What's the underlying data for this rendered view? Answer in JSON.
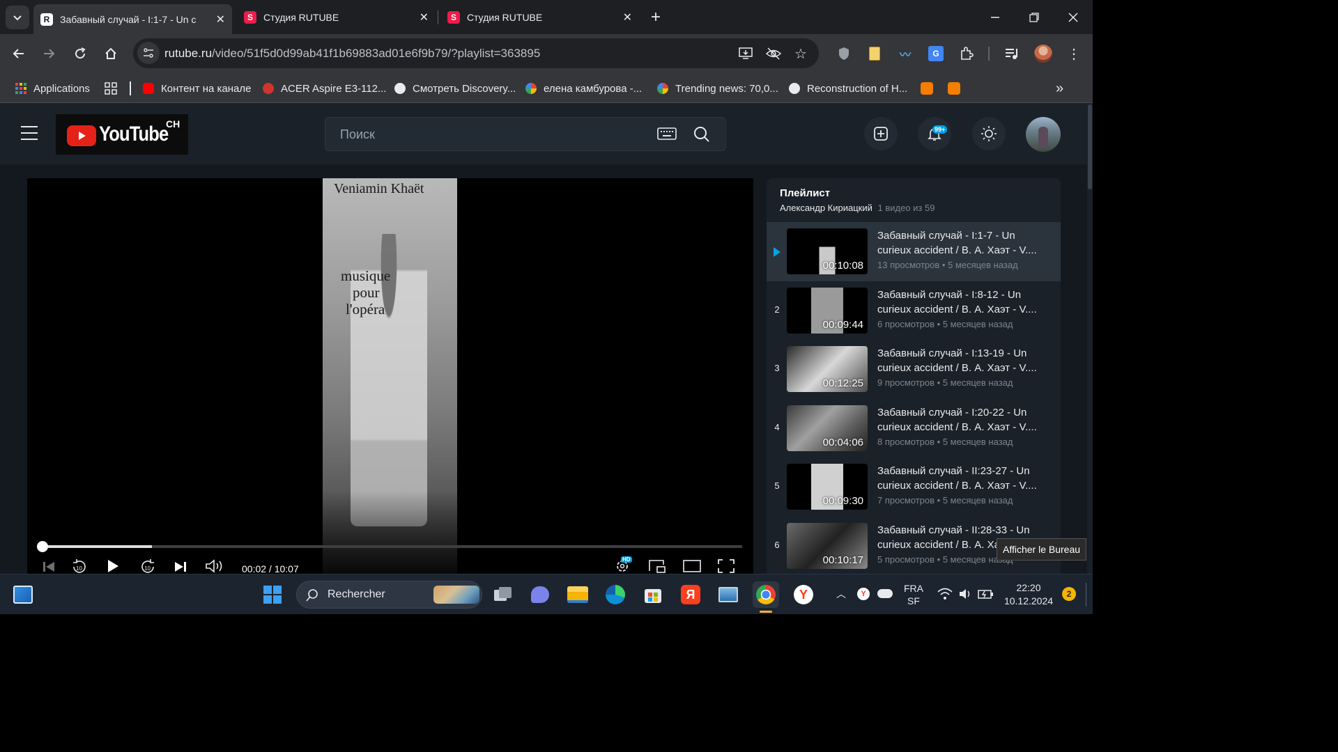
{
  "browser": {
    "tabs": [
      {
        "title": "Забавный случай - I:1-7 - Un c",
        "favicon_letter": "R",
        "active": true
      },
      {
        "title": "Студия RUTUBE",
        "favicon_letter": "S",
        "active": false
      },
      {
        "title": "Студия RUTUBE",
        "favicon_letter": "S",
        "active": false
      }
    ],
    "url_host": "rutube.ru",
    "url_path": "/video/51f5d0d99ab41f1b69883ad01e6f9b79/?playlist=363895",
    "bookmarks": [
      {
        "label": "Applications",
        "icon": "apps-grid-icon",
        "color": "#e8453c"
      },
      {
        "label": "Контент на канале",
        "icon": "youtube-icon",
        "color": "#ff0000"
      },
      {
        "label": "ACER Aspire E3-112...",
        "icon": "acer-icon",
        "color": "#d0342c"
      },
      {
        "label": "Смотреть Discovery...",
        "icon": "globe-icon",
        "color": "#e8eaed"
      },
      {
        "label": "елена камбурова -...",
        "icon": "google-icon",
        "color": "#4285f4"
      },
      {
        "label": "Trending news: 70,0...",
        "icon": "google-icon",
        "color": "#4285f4"
      },
      {
        "label": "Reconstruction of H...",
        "icon": "globe-icon",
        "color": "#e8eaed"
      }
    ],
    "more_bookmarks": "»"
  },
  "site": {
    "logo_text": "YouTube",
    "logo_badge": "CH",
    "search_placeholder": "Поиск",
    "notifications_badge": "99+"
  },
  "video": {
    "overlay_title": "Veniamin Khaët",
    "overlay_lines": [
      "musique",
      "pour",
      "l'opéra"
    ],
    "time_current": "00:02",
    "time_total": "10:07",
    "time_display": "00:02 / 10:07",
    "progress_fraction": 0.003,
    "buffered_fraction": 0.16,
    "quality_badge": "HD"
  },
  "playlist": {
    "heading": "Плейлист",
    "author": "Александр Кириацкий",
    "count_text": "1 видео из 59",
    "items": [
      {
        "num": "",
        "duration": "00:10:08",
        "title": "Забавный случай - I:1-7 - Un curieux accident / В. А. Хаэт - V....",
        "views": "13 просмотров",
        "age": "5 месяцев назад",
        "current": true
      },
      {
        "num": "2",
        "duration": "00:09:44",
        "title": "Забавный случай - I:8-12 - Un curieux accident / В. А. Хаэт - V....",
        "views": "6 просмотров",
        "age": "5 месяцев назад",
        "current": false
      },
      {
        "num": "3",
        "duration": "00:12:25",
        "title": "Забавный случай - I:13-19 - Un curieux accident / В. А. Хаэт - V....",
        "views": "9 просмотров",
        "age": "5 месяцев назад",
        "current": false
      },
      {
        "num": "4",
        "duration": "00:04:06",
        "title": "Забавный случай - I:20-22 - Un curieux accident / В. А. Хаэт - V....",
        "views": "8 просмотров",
        "age": "5 месяцев назад",
        "current": false
      },
      {
        "num": "5",
        "duration": "00:09:30",
        "title": "Забавный случай - II:23-27 - Un curieux accident / В. А. Хаэт - V....",
        "views": "7 просмотров",
        "age": "5 месяцев назад",
        "current": false
      },
      {
        "num": "6",
        "duration": "00:10:17",
        "title": "Забавный случай - II:28-33 - Un curieux accident / В. А. Хаэт - V....",
        "views": "5 просмотров",
        "age": "5 месяцев назад",
        "current": false
      }
    ]
  },
  "tooltip": "Afficher le Bureau",
  "taskbar": {
    "search_label": "Rechercher",
    "lang": "FRA",
    "lang_sub": "SF",
    "time": "22:20",
    "date": "10.12.2024",
    "notif_count": "2"
  }
}
